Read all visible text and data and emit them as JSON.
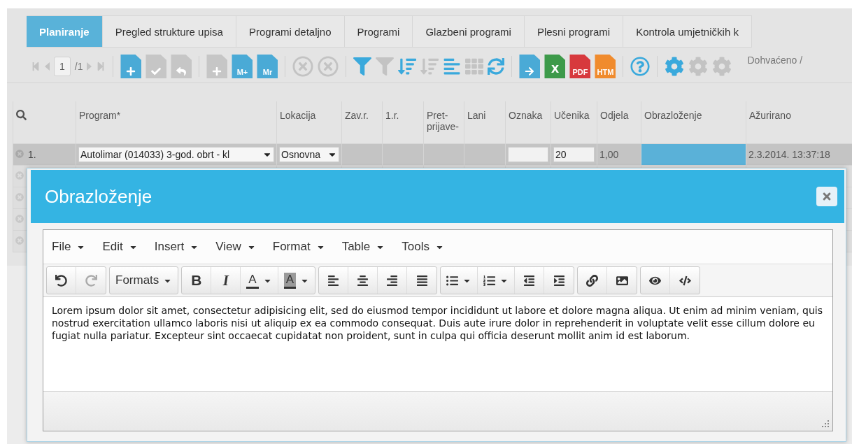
{
  "tabs": [
    {
      "label": "Planiranje",
      "selected": true
    },
    {
      "label": "Pregled strukture upisa",
      "selected": false
    },
    {
      "label": "Programi detaljno",
      "selected": false
    },
    {
      "label": "Programi",
      "selected": false
    },
    {
      "label": "Glazbeni programi",
      "selected": false
    },
    {
      "label": "Plesni programi",
      "selected": false
    },
    {
      "label": "Kontrola umjetničkih k",
      "selected": false
    }
  ],
  "toolbar": {
    "items": [
      {
        "kind": "first",
        "disabled": true
      },
      {
        "kind": "prev",
        "disabled": true
      },
      {
        "kind": "page",
        "label": "1"
      },
      {
        "kind": "count",
        "label": "/1"
      },
      {
        "kind": "next",
        "disabled": true
      },
      {
        "kind": "last",
        "disabled": true
      },
      {
        "kind": "sep"
      },
      {
        "kind": "doc-add",
        "disabled": false
      },
      {
        "kind": "doc-check",
        "disabled": true
      },
      {
        "kind": "doc-undo",
        "disabled": true
      },
      {
        "kind": "sep"
      },
      {
        "kind": "doc-plus",
        "disabled": true
      },
      {
        "kind": "doc-label",
        "label": "M+",
        "color": "#4aaad6",
        "disabled": false
      },
      {
        "kind": "doc-label",
        "label": "Mr",
        "color": "#4aaad6",
        "disabled": false
      },
      {
        "kind": "sep"
      },
      {
        "kind": "cancel",
        "disabled": true
      },
      {
        "kind": "cancel-all",
        "disabled": true
      },
      {
        "kind": "sep"
      },
      {
        "kind": "filter",
        "disabled": false
      },
      {
        "kind": "filter-clear",
        "disabled": true
      },
      {
        "kind": "sort",
        "disabled": false
      },
      {
        "kind": "sort-clear",
        "disabled": true
      },
      {
        "kind": "columns",
        "disabled": false
      },
      {
        "kind": "grid",
        "disabled": true
      },
      {
        "kind": "refresh",
        "disabled": false
      },
      {
        "kind": "sep"
      },
      {
        "kind": "doc-export",
        "disabled": false
      },
      {
        "kind": "doc-label",
        "label": "x",
        "color": "#3d9a4a",
        "disabled": false
      },
      {
        "kind": "doc-label",
        "label": "PDF",
        "color": "#d7393d",
        "disabled": false
      },
      {
        "kind": "doc-label",
        "label": "HTM",
        "color": "#f08b2d",
        "disabled": false
      },
      {
        "kind": "sep"
      },
      {
        "kind": "help",
        "disabled": false
      },
      {
        "kind": "sep"
      },
      {
        "kind": "gear",
        "disabled": false
      },
      {
        "kind": "gear-back",
        "disabled": true
      },
      {
        "kind": "gear-check",
        "disabled": true
      }
    ],
    "status": "Dohvaćeno /"
  },
  "table": {
    "columns": [
      "Program*",
      "Lokacija",
      "Zav.r.",
      "1.r.",
      "Pret- prijave-",
      "Lani",
      "Oznaka",
      "Učenika",
      "Odjela",
      "Obrazloženje",
      "Ažurirano"
    ],
    "rows": [
      {
        "selected": true,
        "number": "1.",
        "program": "Autolimar (014033) 3-god. obrt - kl",
        "lokacija": "Osnovna",
        "ucenika": "20",
        "odjela": "1,00",
        "obrazlozenje_active": true,
        "azurirano": "2.3.2014. 13:37:18"
      },
      {
        "selected": false
      },
      {
        "selected": false
      },
      {
        "selected": false
      },
      {
        "selected": false
      }
    ]
  },
  "dialog": {
    "title": "Obrazloženje",
    "menu": [
      "File",
      "Edit",
      "Insert",
      "View",
      "Format",
      "Table",
      "Tools"
    ],
    "toolbar_groups": [
      [
        {
          "kind": "undo",
          "disabled": false
        },
        {
          "kind": "redo",
          "disabled": true
        }
      ],
      [
        {
          "kind": "formats",
          "label": "Formats"
        }
      ],
      [
        {
          "kind": "bold",
          "label": "B"
        },
        {
          "kind": "italic",
          "label": "I"
        },
        {
          "kind": "text-color",
          "label": "A"
        },
        {
          "kind": "bg-color",
          "label": "A"
        }
      ],
      [
        {
          "kind": "align-left"
        },
        {
          "kind": "align-center"
        },
        {
          "kind": "align-right"
        },
        {
          "kind": "justify"
        }
      ],
      [
        {
          "kind": "bullets"
        },
        {
          "kind": "numbers"
        },
        {
          "kind": "outdent"
        },
        {
          "kind": "indent"
        }
      ],
      [
        {
          "kind": "link"
        },
        {
          "kind": "image"
        }
      ],
      [
        {
          "kind": "preview"
        },
        {
          "kind": "code"
        }
      ]
    ],
    "content": "Lorem ipsum dolor sit amet, consectetur adipisicing elit, sed do eiusmod tempor incididunt ut labore et dolore magna aliqua. Ut enim ad minim veniam, quis nostrud exercitation ullamco laboris nisi ut aliquip ex ea commodo consequat. Duis aute irure dolor in reprehenderit in voluptate velit esse cillum dolore eu fugiat nulla pariatur. Excepteur sint occaecat cupidatat non proident, sunt in culpa qui officia deserunt mollit anim id est laborum."
  }
}
